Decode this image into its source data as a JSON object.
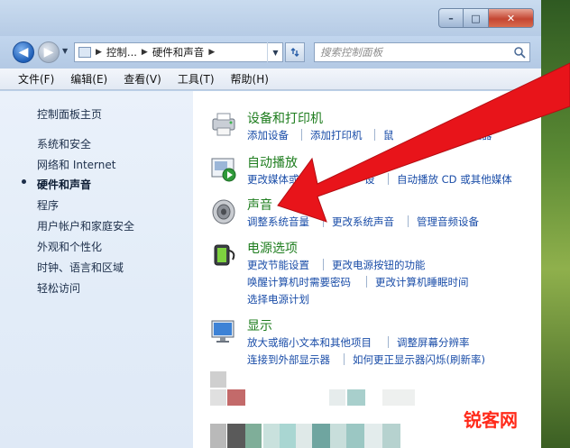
{
  "window": {
    "caption": {
      "minimize": "–",
      "maximize": "□",
      "close": "✕"
    }
  },
  "nav": {
    "back_glyph": "◀",
    "forward_glyph": "▶",
    "address": {
      "crumbs": [
        "控制...",
        "硬件和声音"
      ]
    },
    "search_placeholder": "搜索控制面板"
  },
  "menubar": {
    "items": [
      "文件(F)",
      "编辑(E)",
      "查看(V)",
      "工具(T)",
      "帮助(H)"
    ]
  },
  "sidebar": {
    "items": [
      "控制面板主页",
      "系统和安全",
      "网络和 Internet",
      "硬件和声音",
      "程序",
      "用户帐户和家庭安全",
      "外观和个性化",
      "时钟、语言和区域",
      "轻松访问"
    ],
    "current_index": 3
  },
  "categories": [
    {
      "title": "设备和打印机",
      "icon": "printer-icon",
      "links": [
        "添加设备",
        "添加打印机",
        "鼠",
        "设备管理器"
      ]
    },
    {
      "title": "自动播放",
      "icon": "autoplay-icon",
      "links": [
        "更改媒体或",
        "设",
        "自动播放 CD 或其他媒体"
      ]
    },
    {
      "title": "声音",
      "icon": "speaker-icon",
      "links": [
        "调整系统音量",
        "更改系统声音",
        "管理音频设备"
      ]
    },
    {
      "title": "电源选项",
      "icon": "battery-icon",
      "links": [
        "更改节能设置",
        "更改电源按钮的功能",
        "唤醒计算机时需要密码",
        "更改计算机睡眠时间",
        "选择电源计划"
      ]
    },
    {
      "title": "显示",
      "icon": "display-icon",
      "links": [
        "放大或缩小文本和其他项目",
        "调整屏幕分辨率",
        "连接到外部显示器",
        "如何更正显示器闪烁(刷新率)"
      ]
    }
  ],
  "watermark": "锐客网",
  "colors": {
    "arrow": "#e8141a",
    "category_title": "#1e7d1e",
    "link": "#1a4da8"
  }
}
